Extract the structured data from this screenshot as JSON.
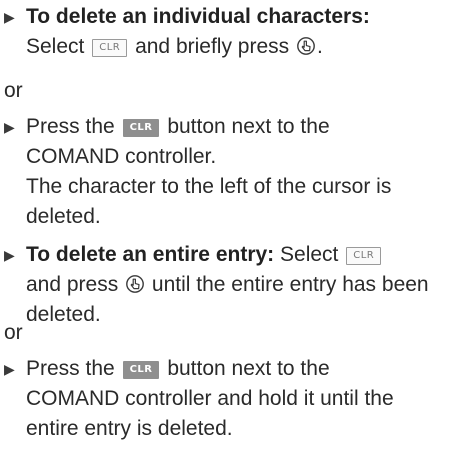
{
  "item1": {
    "heading": "To delete an individual characters:",
    "pre": "Select",
    "key": "CLR",
    "mid": "and briefly press",
    "end": "."
  },
  "or1": "or",
  "item2": {
    "pre": "Press the",
    "key": "CLR",
    "post": "button next to the",
    "line2": "COMAND controller.",
    "line3": "The character to the left of the cursor is",
    "line4": "deleted."
  },
  "item3": {
    "heading": "To delete an entire entry:",
    "pre": "Select",
    "key": "CLR",
    "and": "and press",
    "mid": "until the entire entry has been",
    "line3": "deleted."
  },
  "or2": "or",
  "item4": {
    "pre": "Press the",
    "key": "CLR",
    "post": "button next to the",
    "line2": "COMAND controller and hold it until the",
    "line3": "entire entry is deleted."
  },
  "icons": {
    "bullet": "triangle-right",
    "controller": "comand-controller-press-icon"
  }
}
